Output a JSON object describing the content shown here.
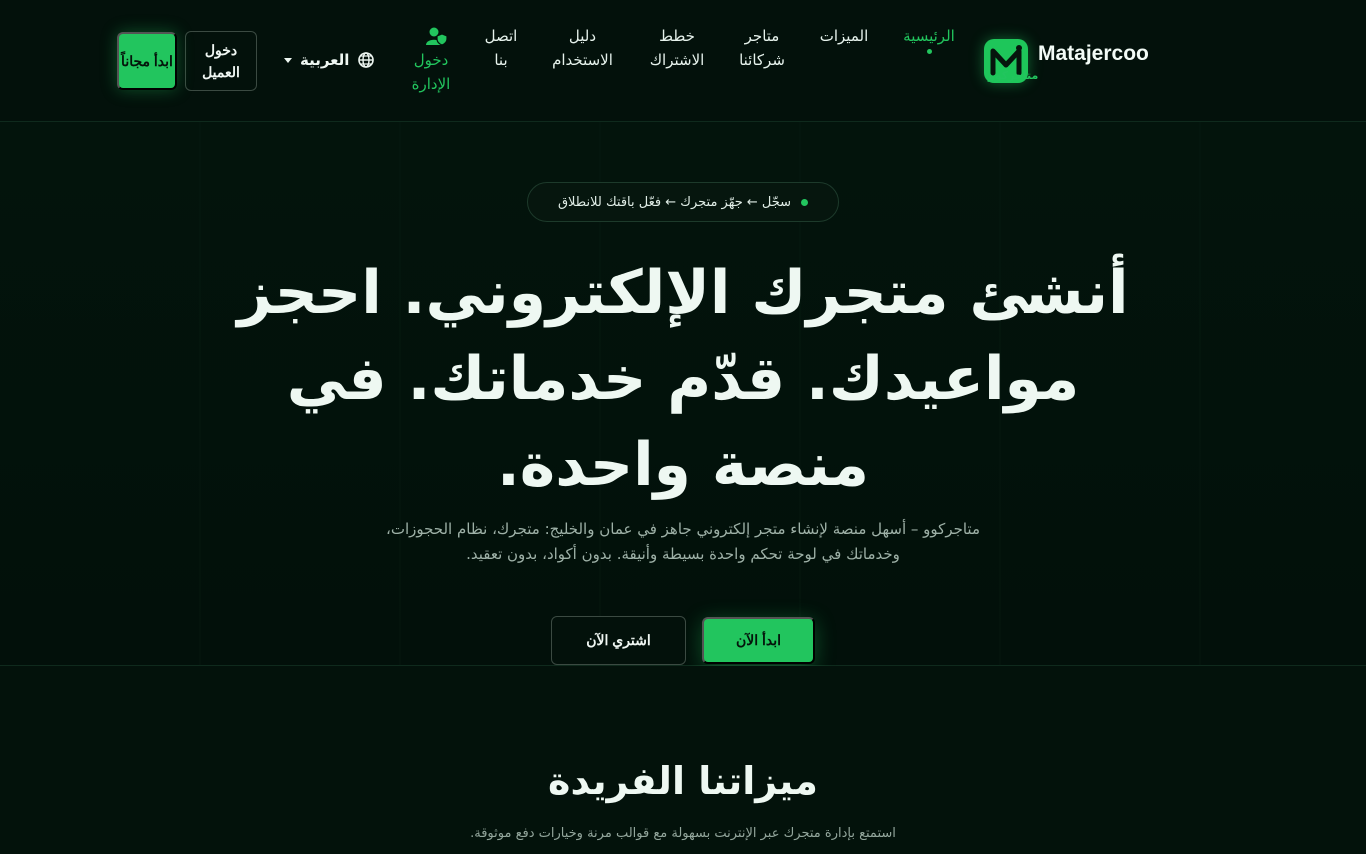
{
  "brand": {
    "name": "Matajercoo",
    "sub": "متاجركوو",
    "logo_letter": "M",
    "accent": "#22c55e"
  },
  "nav": {
    "items": [
      {
        "label": "الرئيسية",
        "active": true
      },
      {
        "label": "الميزات"
      },
      {
        "label": "متاجر شركائنا"
      },
      {
        "label": "خطط الاشتراك"
      },
      {
        "label": "دليل الاستخدام"
      },
      {
        "label": "اتصل بنا"
      }
    ],
    "admin_login": "دخول الإدارة",
    "admin_icon": "user-shield-icon",
    "language": "العربية",
    "language_icon": "globe-icon",
    "client_login": "دخول العميل",
    "start_free": "ابدأ مجاناً"
  },
  "hero": {
    "pill": "سجّل ← جهّز متجرك ← فعّل باقتك للانطلاق",
    "title": "أنشئ متجرك الإلكتروني. احجز مواعيدك. قدّم خدماتك. في منصة واحدة.",
    "description": "متاجركوو – أسهل منصة لإنشاء متجر إلكتروني جاهز في عمان والخليج: متجرك، نظام الحجوزات، وخدماتك في لوحة تحكم واحدة بسيطة وأنيقة. بدون أكواد، بدون تعقيد.",
    "start_now": "ابدأ الآن",
    "buy_now": "اشتري الآن"
  },
  "features": {
    "title": "ميزاتنا الفريدة",
    "subtitle": "استمتع بإدارة متجرك عبر الإنترنت بسهولة مع قوالب مرنة وخيارات دفع موثوقة."
  }
}
